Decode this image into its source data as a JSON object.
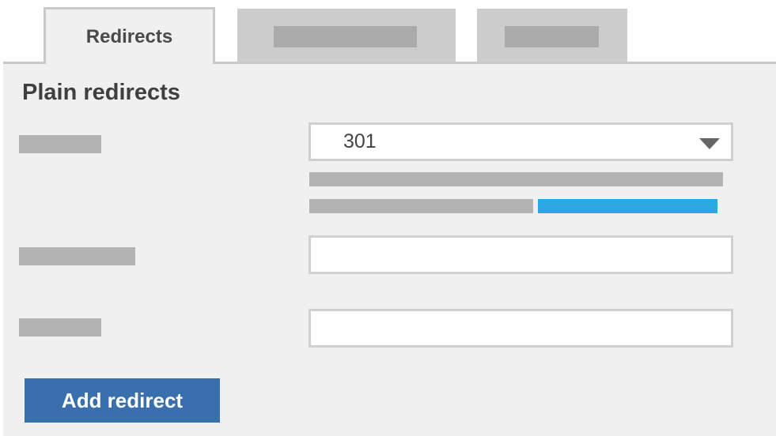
{
  "tabs": [
    {
      "label": "Redirects",
      "active": true
    },
    {
      "label": "",
      "active": false
    },
    {
      "label": "",
      "active": false
    }
  ],
  "section": {
    "title": "Plain redirects"
  },
  "form": {
    "redirect_type": {
      "selected": "301"
    },
    "source_field": {
      "value": ""
    },
    "target_field": {
      "value": ""
    }
  },
  "actions": {
    "add_redirect_label": "Add redirect"
  },
  "colors": {
    "accent_button": "#3a6fad",
    "help_link": "#2aa8e0",
    "panel_background": "#f0f0f0",
    "placeholder": "#b3b3b3"
  }
}
